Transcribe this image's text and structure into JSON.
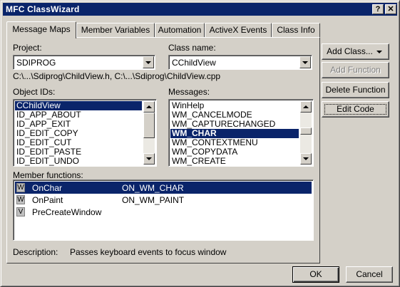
{
  "window": {
    "title": "MFC ClassWizard",
    "help_btn": "?",
    "close_btn": "✕"
  },
  "tabs": [
    "Message Maps",
    "Member Variables",
    "Automation",
    "ActiveX Events",
    "Class Info"
  ],
  "project": {
    "label": "Project:",
    "value": "SDIPROG"
  },
  "class_name": {
    "label": "Class name:",
    "value": "CChildView"
  },
  "file_path": "C:\\...\\Sdiprog\\ChildView.h, C:\\...\\Sdiprog\\ChildView.cpp",
  "object_ids": {
    "label": "Object IDs:",
    "items": [
      "CChildView",
      "ID_APP_ABOUT",
      "ID_APP_EXIT",
      "ID_EDIT_COPY",
      "ID_EDIT_CUT",
      "ID_EDIT_PASTE",
      "ID_EDIT_UNDO"
    ],
    "selected_index": 0
  },
  "messages": {
    "label": "Messages:",
    "items": [
      "WinHelp",
      "WM_CANCELMODE",
      "WM_CAPTURECHANGED",
      "WM_CHAR",
      "WM_CONTEXTMENU",
      "WM_COPYDATA",
      "WM_CREATE"
    ],
    "selected_index": 3
  },
  "member_functions": {
    "label": "Member functions:",
    "rows": [
      {
        "icon": "W",
        "name": "OnChar",
        "handler": "ON_WM_CHAR"
      },
      {
        "icon": "W",
        "name": "OnPaint",
        "handler": "ON_WM_PAINT"
      },
      {
        "icon": "V",
        "name": "PreCreateWindow",
        "handler": ""
      }
    ],
    "selected_index": 0
  },
  "description": {
    "label": "Description:",
    "text": "Passes keyboard events to focus window"
  },
  "buttons": {
    "add_class": "Add Class...",
    "add_function": "Add Function",
    "delete_function": "Delete Function",
    "edit_code": "Edit Code",
    "ok": "OK",
    "cancel": "Cancel"
  },
  "colors": {
    "titlebar": "#0a246a",
    "face": "#d4d0c8",
    "selection": "#0a246a"
  }
}
